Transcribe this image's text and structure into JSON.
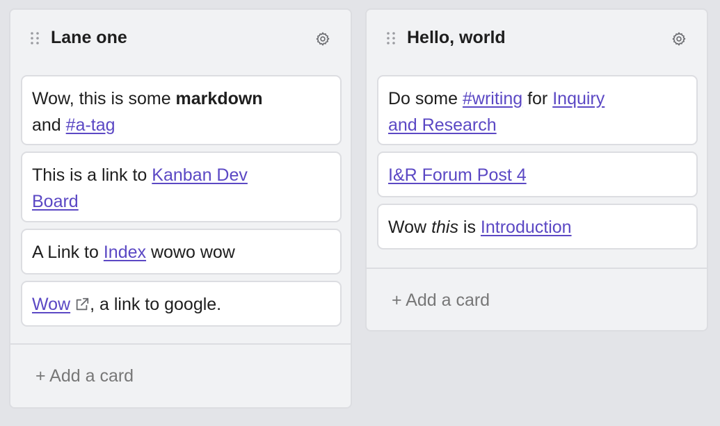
{
  "lanes": [
    {
      "title": "Lane one",
      "add_card_label": "+ Add a card",
      "cards": [
        {
          "parts": [
            "Wow, this is some ",
            "markdown",
            "and ",
            "#a-tag"
          ]
        },
        {
          "parts": [
            "This is a link to ",
            "Kanban Dev",
            "Board"
          ]
        },
        {
          "parts": [
            "A Link to ",
            "Index",
            " wowo wow"
          ]
        },
        {
          "parts": [
            "Wow",
            ", a link to google."
          ]
        }
      ]
    },
    {
      "title": "Hello, world",
      "add_card_label": "+ Add a card",
      "cards": [
        {
          "parts": [
            "Do some ",
            "#writing",
            " for ",
            "Inquiry",
            "and Research"
          ]
        },
        {
          "parts": [
            "I&R Forum Post 4"
          ]
        },
        {
          "parts": [
            "Wow ",
            "this",
            " is ",
            "Introduction"
          ]
        }
      ]
    }
  ],
  "icons": {
    "drag": "drag-handle-icon",
    "settings": "gear-icon",
    "external": "external-link-icon"
  },
  "colors": {
    "link": "#5b48c4",
    "lane_bg": "#f1f2f4",
    "board_bg": "#e3e4e8"
  }
}
